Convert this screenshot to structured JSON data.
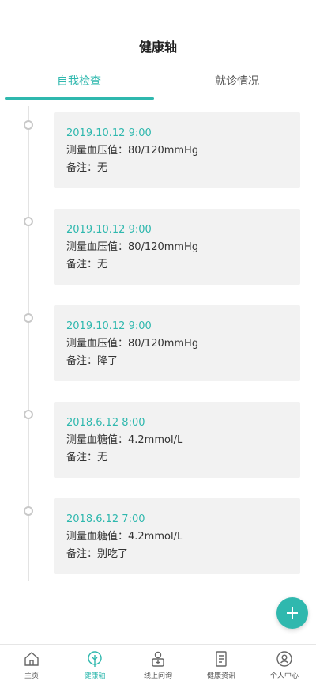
{
  "header": {
    "title": "健康轴"
  },
  "tabs": [
    {
      "label": "自我检查",
      "active": true
    },
    {
      "label": "就诊情况",
      "active": false
    }
  ],
  "entries": [
    {
      "time": "2019.10.12 9:00",
      "measure": "测量血压值：80/120mmHg",
      "note": "备注：无"
    },
    {
      "time": "2019.10.12 9:00",
      "measure": "测量血压值：80/120mmHg",
      "note": "备注：无"
    },
    {
      "time": "2019.10.12 9:00",
      "measure": "测量血压值：80/120mmHg",
      "note": "备注：降了"
    },
    {
      "time": "2018.6.12 8:00",
      "measure": "测量血糖值：4.2mmol/L",
      "note": "备注：无"
    },
    {
      "time": "2018.6.12 7:00",
      "measure": "测量血糖值：4.2mmol/L",
      "note": "备注：别吃了"
    }
  ],
  "fab": {
    "icon": "plus-icon"
  },
  "bottom_nav": [
    {
      "label": "主页",
      "icon": "home-icon",
      "active": false
    },
    {
      "label": "健康轴",
      "icon": "timeline-icon",
      "active": true
    },
    {
      "label": "线上问询",
      "icon": "consult-icon",
      "active": false
    },
    {
      "label": "健康资讯",
      "icon": "news-icon",
      "active": false
    },
    {
      "label": "个人中心",
      "icon": "user-icon",
      "active": false
    }
  ],
  "colors": {
    "accent": "#2fb8ae",
    "card_bg": "#f2f2f2",
    "text": "#333333"
  }
}
